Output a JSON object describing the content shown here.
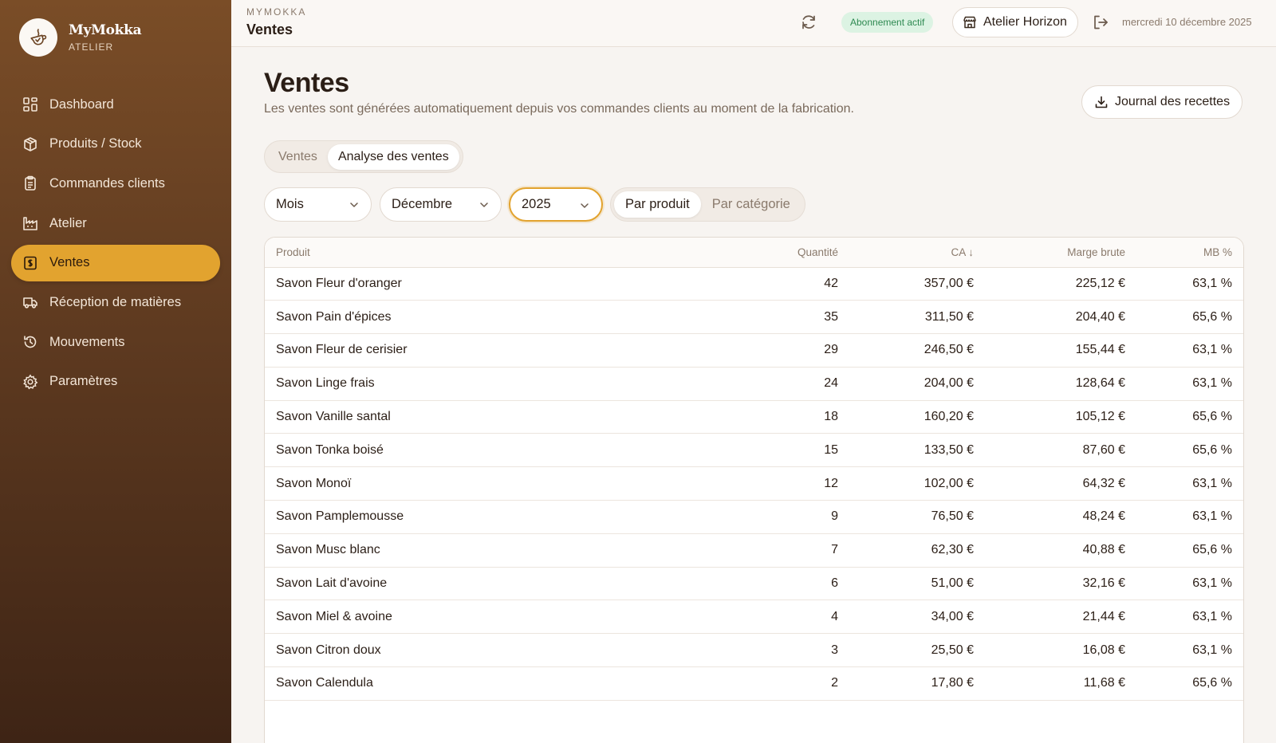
{
  "brand": {
    "name": "MyMokka",
    "sub": "ATELIER"
  },
  "sidebar": {
    "items": [
      {
        "label": "Dashboard",
        "icon": "dashboard-icon",
        "active": false
      },
      {
        "label": "Produits / Stock",
        "icon": "box-icon",
        "active": false
      },
      {
        "label": "Commandes clients",
        "icon": "clipboard-icon",
        "active": false
      },
      {
        "label": "Atelier",
        "icon": "factory-icon",
        "active": false
      },
      {
        "label": "Ventes",
        "icon": "receipt-icon",
        "active": true
      },
      {
        "label": "Réception de matières",
        "icon": "truck-icon",
        "active": false
      },
      {
        "label": "Mouvements",
        "icon": "history-icon",
        "active": false
      },
      {
        "label": "Paramètres",
        "icon": "gear-icon",
        "active": false
      }
    ]
  },
  "topbar": {
    "app": "MYMOKKA",
    "page": "Ventes",
    "badge": "Abonnement actif",
    "workshop": "Atelier Horizon",
    "date": "mercredi 10 décembre 2025"
  },
  "main": {
    "title": "Ventes",
    "subtitle": "Les ventes sont générées automatiquement depuis vos commandes clients au moment de la fabrication.",
    "journal_label": "Journal des recettes",
    "tabs": [
      {
        "label": "Ventes",
        "active": false
      },
      {
        "label": "Analyse des ventes",
        "active": true
      }
    ],
    "filters": {
      "period": "Mois",
      "month": "Décembre",
      "year": "2025"
    },
    "group_toggle": [
      {
        "label": "Par produit",
        "active": true
      },
      {
        "label": "Par catégorie",
        "active": false
      }
    ],
    "table": {
      "headers": {
        "product": "Produit",
        "qty": "Quantité",
        "ca": "CA ↓",
        "margin": "Marge brute",
        "pct": "MB %"
      },
      "rows": [
        {
          "product": "Savon Fleur d'oranger",
          "qty": "42",
          "ca": "357,00 €",
          "margin": "225,12 €",
          "pct": "63,1 %"
        },
        {
          "product": "Savon Pain d'épices",
          "qty": "35",
          "ca": "311,50 €",
          "margin": "204,40 €",
          "pct": "65,6 %"
        },
        {
          "product": "Savon Fleur de cerisier",
          "qty": "29",
          "ca": "246,50 €",
          "margin": "155,44 €",
          "pct": "63,1 %"
        },
        {
          "product": "Savon Linge frais",
          "qty": "24",
          "ca": "204,00 €",
          "margin": "128,64 €",
          "pct": "63,1 %"
        },
        {
          "product": "Savon Vanille santal",
          "qty": "18",
          "ca": "160,20 €",
          "margin": "105,12 €",
          "pct": "65,6 %"
        },
        {
          "product": "Savon Tonka boisé",
          "qty": "15",
          "ca": "133,50 €",
          "margin": "87,60 €",
          "pct": "65,6 %"
        },
        {
          "product": "Savon Monoï",
          "qty": "12",
          "ca": "102,00 €",
          "margin": "64,32 €",
          "pct": "63,1 %"
        },
        {
          "product": "Savon Pamplemousse",
          "qty": "9",
          "ca": "76,50 €",
          "margin": "48,24 €",
          "pct": "63,1 %"
        },
        {
          "product": "Savon Musc blanc",
          "qty": "7",
          "ca": "62,30 €",
          "margin": "40,88 €",
          "pct": "65,6 %"
        },
        {
          "product": "Savon Lait d'avoine",
          "qty": "6",
          "ca": "51,00 €",
          "margin": "32,16 €",
          "pct": "63,1 %"
        },
        {
          "product": "Savon Miel & avoine",
          "qty": "4",
          "ca": "34,00 €",
          "margin": "21,44 €",
          "pct": "63,1 %"
        },
        {
          "product": "Savon Citron doux",
          "qty": "3",
          "ca": "25,50 €",
          "margin": "16,08 €",
          "pct": "63,1 %"
        },
        {
          "product": "Savon Calendula",
          "qty": "2",
          "ca": "17,80 €",
          "margin": "11,68 €",
          "pct": "65,6 %"
        }
      ]
    }
  },
  "colors": {
    "accent": "#e2a32f",
    "sidebar_top": "#7a4d27",
    "sidebar_bottom": "#3e2415",
    "badge_bg": "#dcf3e3",
    "badge_text": "#2f8a52"
  }
}
